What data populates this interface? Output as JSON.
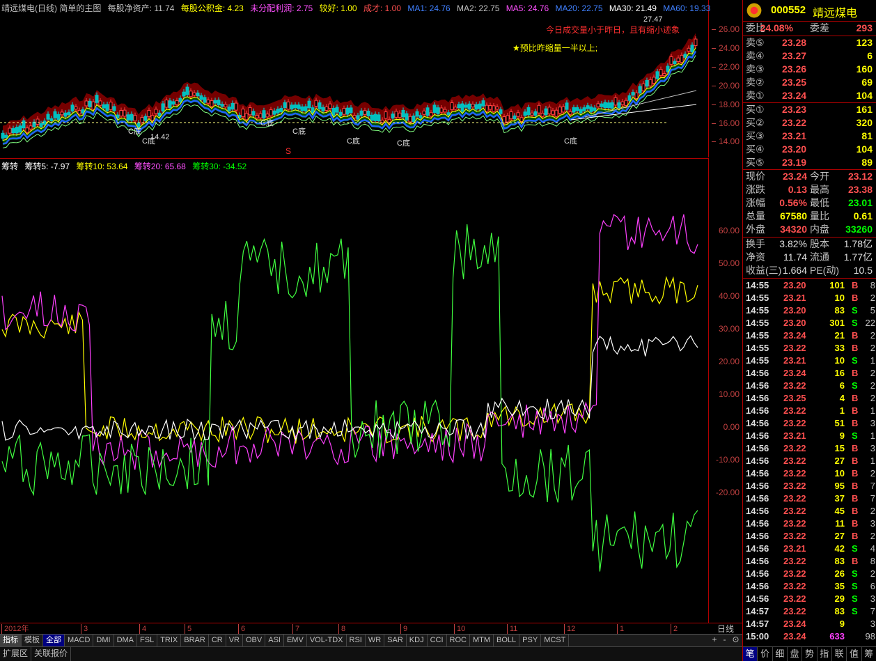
{
  "main_header": {
    "title": "靖远煤电(日线) 简单的主图",
    "nav_per_share": "每股净资产: 11.74",
    "reserve_per_share": "每股公积金: 4.23",
    "undist_profit": "未分配利润: 2.75",
    "rating": "较好: 1.00",
    "cost": "成才: 1.00",
    "ma1": "MA1: 24.76",
    "ma2": "MA2: 22.75",
    "ma5": "MA5: 24.76",
    "ma20": "MA20: 22.75",
    "ma30": "MA30: 21.49",
    "ma60": "MA60: 19.33"
  },
  "annotations": {
    "high_price": "27.47",
    "low_price": "14.42",
    "note1": "今日成交量小于昨日，且有缩小迹象",
    "note2": "★预比昨缩量一半以上;",
    "bottom_label": "C底",
    "signal_s": "S"
  },
  "price_ticks": [
    "26.00",
    "24.00",
    "22.00",
    "20.00",
    "18.00",
    "16.00",
    "14.00"
  ],
  "indicator_header": {
    "name": "筹转",
    "s5": "筹转5: -7.97",
    "s10": "筹转10: 53.64",
    "s20": "筹转20: 65.68",
    "s30": "筹转30: -34.52"
  },
  "indicator_ticks": [
    "60.00",
    "50.00",
    "40.00",
    "30.00",
    "20.00",
    "10.00",
    "0.00",
    "-10.00",
    "-20.00"
  ],
  "date_axis": [
    "2012年",
    "3",
    "4",
    "5",
    "6",
    "7",
    "8",
    "9",
    "10",
    "11",
    "12",
    "1",
    "2"
  ],
  "period": "日线",
  "bottom_tabs": [
    "指标",
    "模板",
    "全部",
    "MACD",
    "DMI",
    "DMA",
    "FSL",
    "TRIX",
    "BRAR",
    "CR",
    "VR",
    "OBV",
    "ASI",
    "EMV",
    "VOL-TDX",
    "RSI",
    "WR",
    "SAR",
    "KDJ",
    "CCI",
    "ROC",
    "MTM",
    "BOLL",
    "PSY",
    "MCST"
  ],
  "zoom": [
    "+",
    "-",
    "⊙"
  ],
  "sub_tabs": [
    "扩展区",
    "关联报价"
  ],
  "stock": {
    "code": "000552",
    "name": "靖远煤电"
  },
  "commission": {
    "ratio_label": "委比",
    "ratio": "24.08%",
    "diff_label": "委差",
    "diff": "293"
  },
  "sells": [
    {
      "label": "卖⑤",
      "price": "23.28",
      "vol": "123"
    },
    {
      "label": "卖④",
      "price": "23.27",
      "vol": "6"
    },
    {
      "label": "卖③",
      "price": "23.26",
      "vol": "160"
    },
    {
      "label": "卖②",
      "price": "23.25",
      "vol": "69"
    },
    {
      "label": "卖①",
      "price": "23.24",
      "vol": "104"
    }
  ],
  "buys": [
    {
      "label": "买①",
      "price": "23.23",
      "vol": "161"
    },
    {
      "label": "买②",
      "price": "23.22",
      "vol": "320"
    },
    {
      "label": "买③",
      "price": "23.21",
      "vol": "81"
    },
    {
      "label": "买④",
      "price": "23.20",
      "vol": "104"
    },
    {
      "label": "买⑤",
      "price": "23.19",
      "vol": "89"
    }
  ],
  "quote": [
    {
      "l1": "现价",
      "v1": "23.24",
      "c1": "red",
      "l2": "今开",
      "v2": "23.12",
      "c2": "red"
    },
    {
      "l1": "涨跌",
      "v1": "0.13",
      "c1": "red",
      "l2": "最高",
      "v2": "23.38",
      "c2": "red"
    },
    {
      "l1": "涨幅",
      "v1": "0.56%",
      "c1": "red",
      "l2": "最低",
      "v2": "23.01",
      "c2": "green"
    },
    {
      "l1": "总量",
      "v1": "67580",
      "c1": "yellow",
      "l2": "量比",
      "v2": "0.61",
      "c2": "yellow"
    },
    {
      "l1": "外盘",
      "v1": "34320",
      "c1": "red",
      "l2": "内盘",
      "v2": "33260",
      "c2": "green"
    }
  ],
  "fundamentals": [
    {
      "l1": "换手",
      "v1": "3.82%",
      "l2": "股本",
      "v2": "1.78亿"
    },
    {
      "l1": "净资",
      "v1": "11.74",
      "l2": "流通",
      "v2": "1.77亿"
    },
    {
      "l1": "收益(三)",
      "v1": "1.664",
      "l2": "PE(动)",
      "v2": "10.5"
    }
  ],
  "trades": [
    {
      "t": "14:55",
      "p": "23.20",
      "v": "101",
      "s": "B",
      "n": "8"
    },
    {
      "t": "14:55",
      "p": "23.21",
      "v": "10",
      "s": "B",
      "n": "2"
    },
    {
      "t": "14:55",
      "p": "23.20",
      "v": "83",
      "s": "S",
      "n": "5"
    },
    {
      "t": "14:55",
      "p": "23.20",
      "v": "301",
      "s": "S",
      "n": "22"
    },
    {
      "t": "14:55",
      "p": "23.24",
      "v": "21",
      "s": "B",
      "n": "2"
    },
    {
      "t": "14:55",
      "p": "23.22",
      "v": "33",
      "s": "B",
      "n": "2"
    },
    {
      "t": "14:55",
      "p": "23.21",
      "v": "10",
      "s": "S",
      "n": "1"
    },
    {
      "t": "14:56",
      "p": "23.24",
      "v": "16",
      "s": "B",
      "n": "2"
    },
    {
      "t": "14:56",
      "p": "23.22",
      "v": "6",
      "s": "S",
      "n": "2"
    },
    {
      "t": "14:56",
      "p": "23.25",
      "v": "4",
      "s": "B",
      "n": "2"
    },
    {
      "t": "14:56",
      "p": "23.22",
      "v": "1",
      "s": "B",
      "n": "1"
    },
    {
      "t": "14:56",
      "p": "23.22",
      "v": "51",
      "s": "B",
      "n": "3"
    },
    {
      "t": "14:56",
      "p": "23.21",
      "v": "9",
      "s": "S",
      "n": "1"
    },
    {
      "t": "14:56",
      "p": "23.22",
      "v": "15",
      "s": "B",
      "n": "3"
    },
    {
      "t": "14:56",
      "p": "23.22",
      "v": "27",
      "s": "B",
      "n": "1"
    },
    {
      "t": "14:56",
      "p": "23.22",
      "v": "10",
      "s": "B",
      "n": "2"
    },
    {
      "t": "14:56",
      "p": "23.22",
      "v": "95",
      "s": "B",
      "n": "7"
    },
    {
      "t": "14:56",
      "p": "23.22",
      "v": "37",
      "s": "B",
      "n": "7"
    },
    {
      "t": "14:56",
      "p": "23.22",
      "v": "45",
      "s": "B",
      "n": "2"
    },
    {
      "t": "14:56",
      "p": "23.22",
      "v": "11",
      "s": "B",
      "n": "3"
    },
    {
      "t": "14:56",
      "p": "23.22",
      "v": "27",
      "s": "B",
      "n": "2"
    },
    {
      "t": "14:56",
      "p": "23.21",
      "v": "42",
      "s": "S",
      "n": "4"
    },
    {
      "t": "14:56",
      "p": "23.22",
      "v": "83",
      "s": "B",
      "n": "8"
    },
    {
      "t": "14:56",
      "p": "23.22",
      "v": "26",
      "s": "S",
      "n": "2"
    },
    {
      "t": "14:56",
      "p": "23.22",
      "v": "35",
      "s": "S",
      "n": "6"
    },
    {
      "t": "14:56",
      "p": "23.22",
      "v": "29",
      "s": "S",
      "n": "3"
    },
    {
      "t": "14:57",
      "p": "23.22",
      "v": "83",
      "s": "S",
      "n": "7"
    },
    {
      "t": "14:57",
      "p": "23.24",
      "v": "9",
      "s": "",
      "n": "3"
    },
    {
      "t": "15:00",
      "p": "23.24",
      "v": "633",
      "s": "",
      "n": "98"
    }
  ],
  "right_tabs": [
    "笔",
    "价",
    "细",
    "盘",
    "势",
    "指",
    "联",
    "值",
    "筹"
  ],
  "colors": {
    "up": "#ff5050",
    "down": "#00ff00",
    "s5": "#ffffff",
    "s10": "#ffff00",
    "s20": "#ff40ff",
    "s30": "#40ff40",
    "grid": "#b00000"
  }
}
